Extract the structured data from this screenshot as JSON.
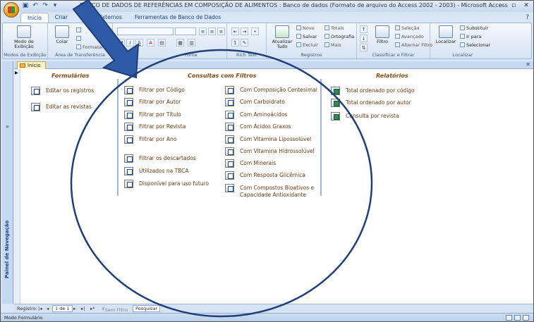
{
  "window": {
    "title": "BANCO DE DADOS DE REFERÊNCIAS EM COMPOSIÇÃO DE ALIMENTOS : Banco de dados (Formato de arquivo do Access 2002 - 2003) - Microsoft Access"
  },
  "ribbon": {
    "tabs": [
      "Início",
      "Criar",
      "Dados Externos",
      "Ferramentas de Banco de Dados"
    ],
    "groups": {
      "views": {
        "label": "Modos de Exibição",
        "button": "Modo de Exibição"
      },
      "clipboard": {
        "label": "Área de Transferência",
        "paste": "Colar",
        "format": "Formatar"
      },
      "font": {
        "label": "Fonte"
      },
      "rich_text": {
        "label": "Rich Text"
      },
      "records": {
        "label": "Registros",
        "refresh": "Atualizar Tudo",
        "new": "Novo",
        "save": "Salvar",
        "delete": "Excluir",
        "totals": "Totais",
        "spelling": "Ortografia",
        "more": "Mais"
      },
      "sort_filter": {
        "label": "Classificar e Filtrar",
        "filter": "Filtro",
        "selection": "Seleção",
        "advanced": "Avançado",
        "toggle": "Alternar Filtro"
      },
      "find": {
        "label": "Localizar",
        "find": "Localizar",
        "replace": "Substituir",
        "goto": "Ir para",
        "select": "Selecionar"
      }
    }
  },
  "nav_pane": {
    "label": "Painel de Navegação"
  },
  "doc_tab": {
    "label": "Início"
  },
  "form": {
    "sections": {
      "forms": {
        "title": "Formulários",
        "items": [
          "Editar os registros",
          "Editar as revistas"
        ]
      },
      "queries": {
        "title": "Consultas com Filtros",
        "col1": [
          "Filtrar por Código",
          "Filtrar por Autor",
          "Filtrar por Título",
          "Filtrar por Revista",
          "Filtrar por Ano"
        ],
        "col1b": [
          "Filtrar os descartados",
          "Utilizados na TBCA",
          "Disponível para uso futuro"
        ],
        "col2": [
          "Com Composição Centesimal",
          "Com Carboidrato",
          "Com Aminoácidos",
          "Com Ácidos Graxos",
          "Com Vitamina Lipossolúvel",
          "Com Vitamina Hidrossolúvel",
          "Com Minerais",
          "Com Resposta Glicêmica"
        ],
        "col2_last_line1": "Com Compostos Bioativos e",
        "col2_last_line2": "Capacidade Antioxidante"
      },
      "reports": {
        "title": "Relatórios",
        "items": [
          "Total ordenado por código",
          "Total ordenado por autor",
          "Consulta por revista"
        ]
      }
    }
  },
  "record_nav": {
    "label": "Registro:",
    "position": "1 de 1",
    "filter": "Sem Filtro",
    "search": "Pesquisar"
  },
  "status": {
    "text": "Modo Formulário"
  },
  "colors": {
    "accent_blue": "#15428b",
    "annotation": "#1f3f7a",
    "item_text": "#6a3a10",
    "header_text": "#8a4a12"
  }
}
